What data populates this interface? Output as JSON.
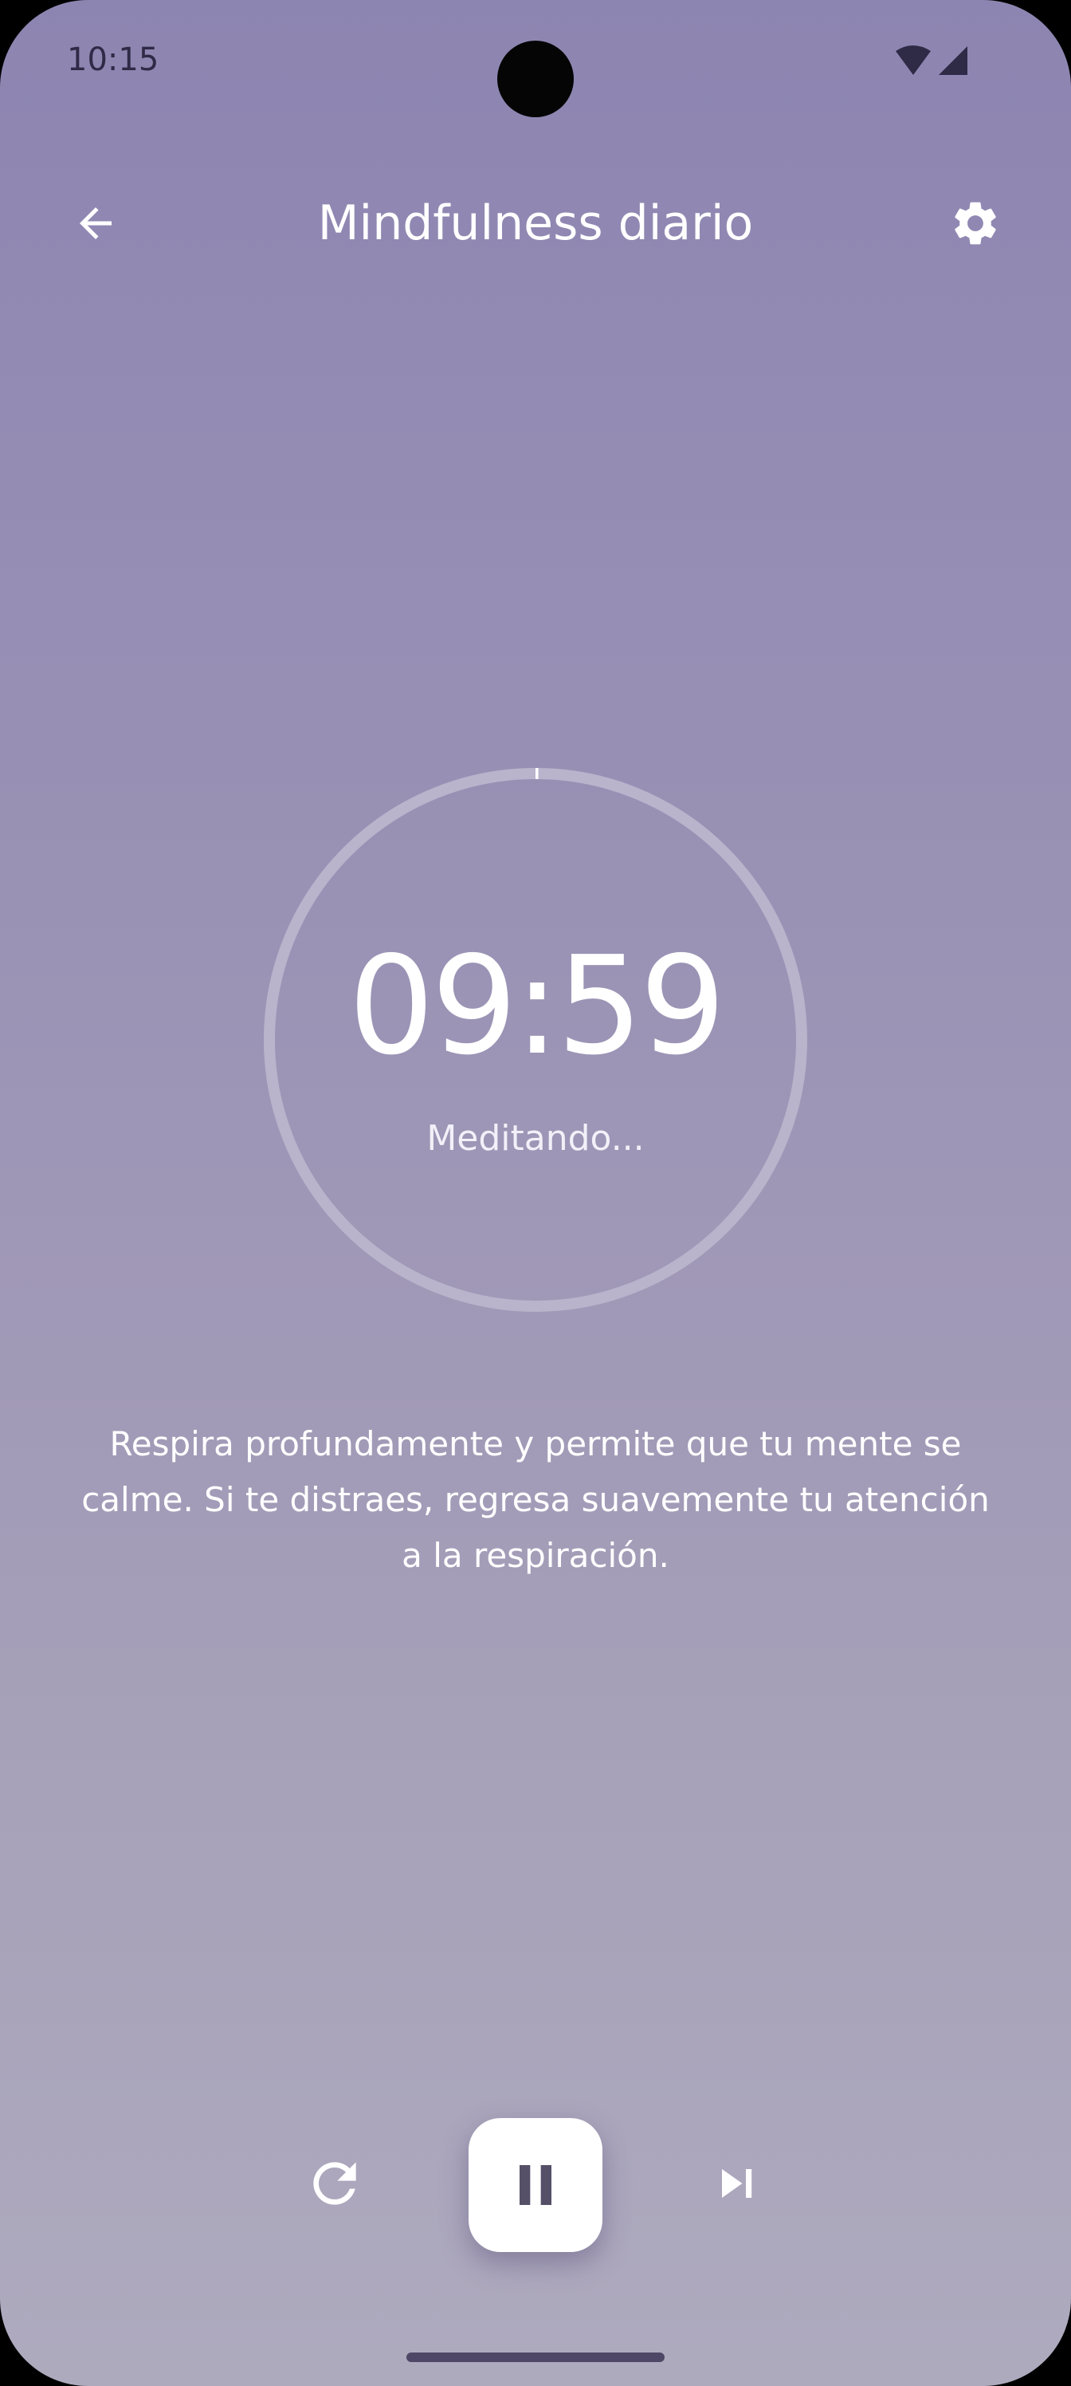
{
  "status_bar": {
    "time": "10:15",
    "icons": [
      "wifi-icon",
      "cell-signal-icon"
    ]
  },
  "app_bar": {
    "title": "Mindfulness diario",
    "back_icon": "arrow-left-icon",
    "settings_icon": "gear-icon"
  },
  "timer": {
    "value": "09:59",
    "status": "Meditando...",
    "progress": 0.0017
  },
  "instructions": {
    "line1": "Respira profundamente y permite que tu mente se",
    "line2": "calme. Si te distraes, regresa suavemente tu atención",
    "line3": "a la respiración."
  },
  "controls": {
    "restart_icon": "restart-icon",
    "pause_icon": "pause-icon",
    "skip_icon": "skip-next-icon"
  },
  "colors": {
    "background_top": "#8d85b1",
    "background_bottom": "#aeaabe",
    "text": "#ffffff",
    "ring_track": "#b9b4cc",
    "home_indicator": "#4e4866"
  }
}
